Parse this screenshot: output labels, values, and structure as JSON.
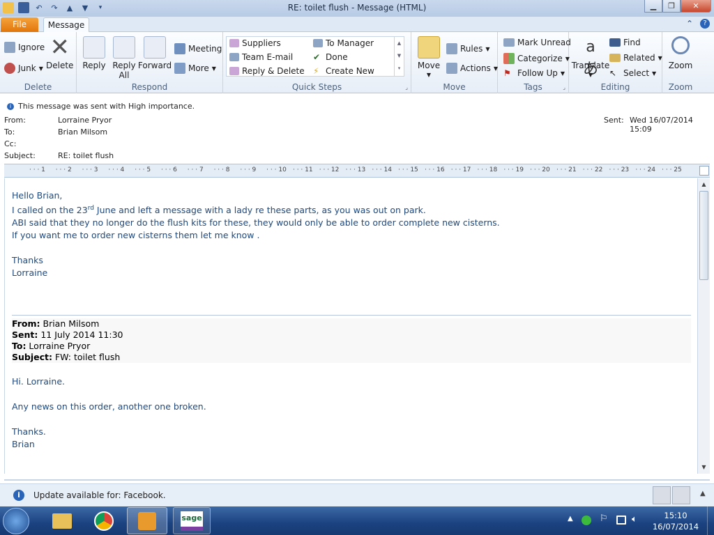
{
  "window": {
    "title": "RE: toilet flush  -  Message (HTML)",
    "controls": {
      "minimize": "▁",
      "maximize": "❐",
      "close": "✕"
    }
  },
  "tabs": [
    {
      "label": "File"
    },
    {
      "label": "Message"
    }
  ],
  "ribbon": {
    "delete": {
      "label": "Delete",
      "ignore": "Ignore",
      "junk": "Junk",
      "delete": "Delete"
    },
    "respond": {
      "label": "Respond",
      "reply": "Reply",
      "reply_all": "Reply All",
      "forward": "Forward",
      "meeting": "Meeting",
      "more": "More"
    },
    "quick_steps": {
      "label": "Quick Steps",
      "items": [
        "Suppliers",
        "To Manager",
        "Team E-mail",
        "Done",
        "Reply & Delete",
        "Create New"
      ]
    },
    "move": {
      "label": "Move",
      "move": "Move",
      "rules": "Rules",
      "actions": "Actions"
    },
    "tags": {
      "label": "Tags",
      "mark_unread": "Mark Unread",
      "categorize": "Categorize",
      "follow_up": "Follow Up"
    },
    "editing": {
      "label": "Editing",
      "translate": "Translate",
      "find": "Find",
      "related": "Related",
      "select": "Select"
    },
    "zoom": {
      "label": "Zoom",
      "zoom": "Zoom"
    }
  },
  "header": {
    "importance": "This message was sent with High importance.",
    "from_label": "From:",
    "from": "Lorraine Pryor",
    "to_label": "To:",
    "to": "Brian Milsom",
    "cc_label": "Cc:",
    "subject_label": "Subject:",
    "subject": "RE: toilet flush",
    "sent_label": "Sent:",
    "sent": "Wed 16/07/2014 15:09"
  },
  "ruler": {
    "ticks": [
      "1",
      "2",
      "3",
      "4",
      "5",
      "6",
      "7",
      "8",
      "9",
      "10",
      "11",
      "12",
      "13",
      "14",
      "15",
      "16",
      "17",
      "18",
      "19",
      "20",
      "21",
      "22",
      "23",
      "24",
      "25"
    ]
  },
  "message": {
    "greeting": "Hello Brian,",
    "line1_a": "I called on the 23",
    "line1_sup": "rd",
    "line1_b": " June and left a message with a lady re these parts, as you was out on park.",
    "line2": "ABI said that they no longer do the flush kits for these, they would only be able to order complete new cisterns.",
    "line3": "If you want me to order new cisterns them let me know .",
    "thanks": "Thanks",
    "signature": "Lorraine"
  },
  "forwarded": {
    "from_label": "From:",
    "from": " Brian Milsom",
    "sent_label": "Sent:",
    "sent": " 11 July 2014 11:30",
    "to_label": "To:",
    "to": " Lorraine Pryor",
    "subject_label": "Subject:",
    "subject": " FW: toilet flush",
    "greeting": "Hi. Lorraine.",
    "body": "Any news on this order, another one broken.",
    "thanks": "Thanks.",
    "signature": "Brian"
  },
  "statusbar": {
    "text": "Update available for: Facebook."
  },
  "taskbar": {
    "time": "15:10",
    "date": "16/07/2014",
    "sage": "sage"
  }
}
